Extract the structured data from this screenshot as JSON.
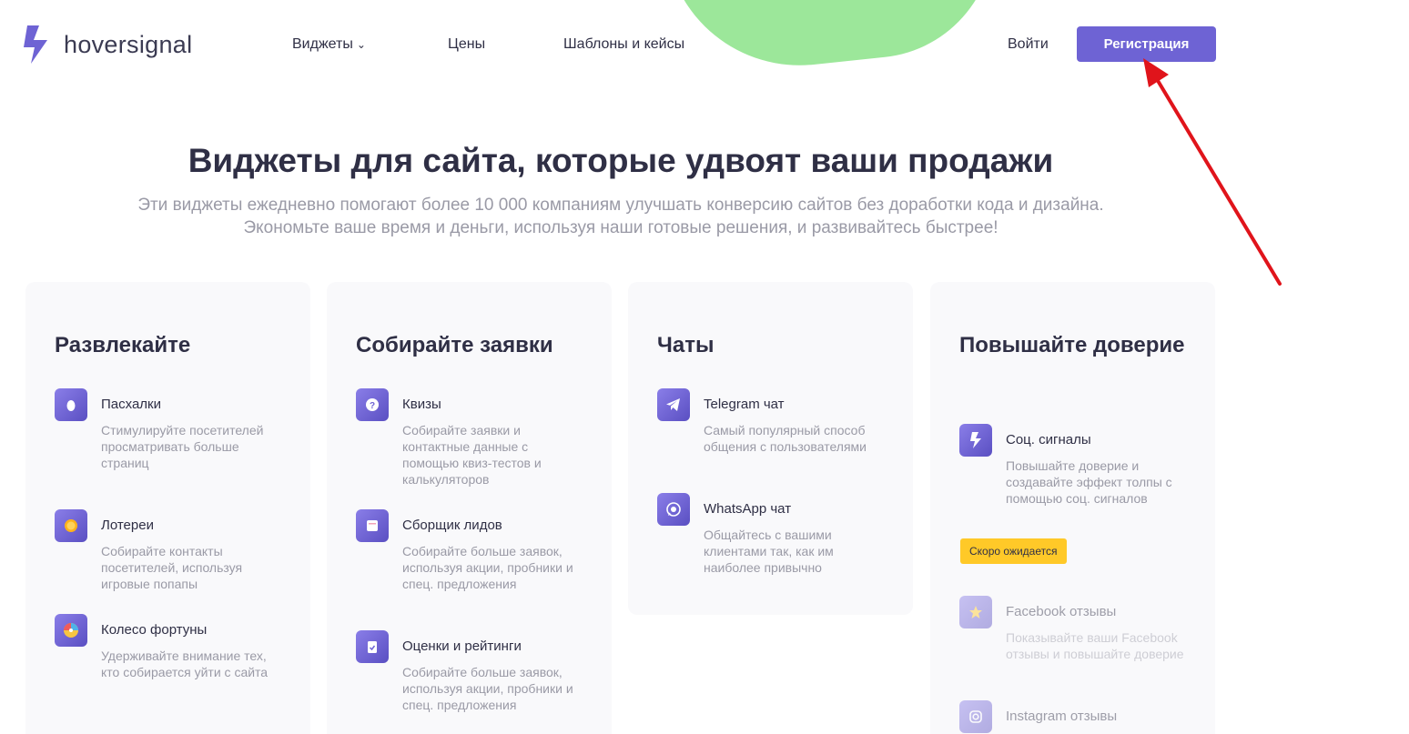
{
  "header": {
    "logo_text": "hoversignal",
    "nav": {
      "widgets": "Виджеты",
      "prices": "Цены",
      "templates": "Шаблоны и кейсы"
    },
    "login": "Войти",
    "register": "Регистрация"
  },
  "hero": {
    "title": "Виджеты для сайта, которые удвоят ваши продажи",
    "subtitle_line1": "Эти виджеты ежедневно помогают более 10 000 компаниям улучшать конверсию сайтов без доработки кода и дизайна.",
    "subtitle_line2": "Экономьте ваше время и деньги, используя наши готовые решения, и развивайтесь быстрее!"
  },
  "cards": [
    {
      "title": "Развлекайте",
      "items": [
        {
          "title": "Пасхалки",
          "desc": "Стимулируйте посетителей просматривать больше страниц",
          "icon": "egg-icon"
        },
        {
          "title": "Лотереи",
          "desc": "Собирайте контакты посетителей, используя игровые попапы",
          "icon": "coin-icon"
        },
        {
          "title": "Колесо фортуны",
          "desc": "Удерживайте внимание тех, кто собирается уйти с сайта",
          "icon": "wheel-icon"
        }
      ]
    },
    {
      "title": "Собирайте заявки",
      "items": [
        {
          "title": "Квизы",
          "desc": "Собирайте заявки и контактные данные с помощью квиз-тестов и калькуляторов",
          "icon": "question-icon"
        },
        {
          "title": "Сборщик лидов",
          "desc": "Собирайте больше заявок, используя акции, пробники и спец. предложения",
          "icon": "form-icon"
        },
        {
          "title": "Оценки и рейтинги",
          "desc": "Собирайте больше заявок, используя акции, пробники и спец. предложения",
          "icon": "clipboard-icon"
        }
      ]
    },
    {
      "title": "Чаты",
      "items": [
        {
          "title": "Telegram чат",
          "desc": "Самый популярный способ общения с пользователями",
          "icon": "telegram-icon"
        },
        {
          "title": "WhatsApp чат",
          "desc": "Общайтесь с вашими клиентами так, как им наиболее привычно",
          "icon": "whatsapp-icon"
        }
      ]
    },
    {
      "title": "Повышайте доверие",
      "items": [
        {
          "title": "Соц. сигналы",
          "desc": "Повышайте доверие и создавайте эффект толпы с помощью соц. сигналов",
          "icon": "lightning-icon"
        },
        {
          "title": "Facebook отзывы",
          "desc": "Показывайте ваши Facebook отзывы и повышайте доверие",
          "icon": "star-icon"
        },
        {
          "title": "Instagram отзывы",
          "desc": "",
          "icon": "instagram-icon"
        }
      ],
      "badge": "Скоро ожидается"
    }
  ],
  "colors": {
    "accent": "#6e63d4",
    "blob": "#9ce79a",
    "badge": "#ffc928",
    "arrow": "#e0141b"
  }
}
